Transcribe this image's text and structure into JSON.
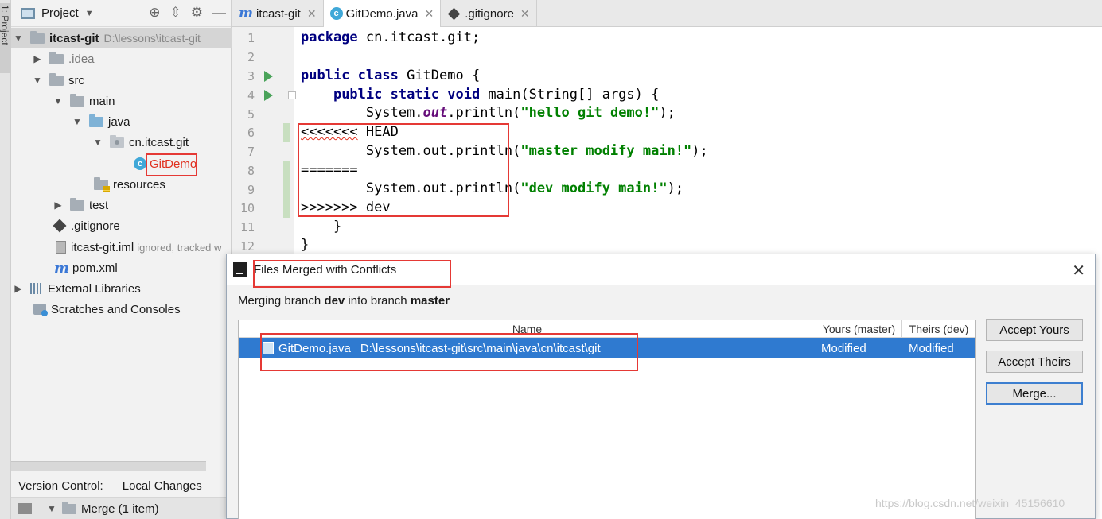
{
  "sidebar_tab": "1: Project",
  "project_panel": {
    "title": "Project",
    "tree": [
      {
        "label": "itcast-git",
        "hint": "D:\\lessons\\itcast-git"
      },
      {
        "label": ".idea"
      },
      {
        "label": "src"
      },
      {
        "label": "main"
      },
      {
        "label": "java"
      },
      {
        "label": "cn.itcast.git"
      },
      {
        "label": "GitDemo"
      },
      {
        "label": "resources"
      },
      {
        "label": "test"
      },
      {
        "label": ".gitignore"
      },
      {
        "label": "itcast-git.iml",
        "hint": "ignored, tracked w"
      },
      {
        "label": "pom.xml"
      },
      {
        "label": "External Libraries"
      },
      {
        "label": "Scratches and Consoles"
      }
    ]
  },
  "version_control": {
    "label": "Version Control:",
    "tab": "Local Changes",
    "group": "Merge (1 item)"
  },
  "editor": {
    "tabs": [
      {
        "label": "itcast-git"
      },
      {
        "label": "GitDemo.java"
      },
      {
        "label": ".gitignore"
      }
    ],
    "code": {
      "l1_kw": "package",
      "l1_rest": " cn.itcast.git;",
      "l3_kw1": "public",
      "l3_kw2": "class",
      "l3_rest": " GitDemo {",
      "l4_kw": "public static void",
      "l4_rest": " main(String[] args) {",
      "l5_pre": "        System.",
      "l5_field": "out",
      "l5_mid": ".println(",
      "l5_str": "\"hello git demo!\"",
      "l5_end": ");",
      "l6_marker": "<<<<<<<",
      "l6_rest": " HEAD",
      "l7_pre": "        System.out.println(",
      "l7_str": "\"master modify main!\"",
      "l7_end": ");",
      "l8": "=======",
      "l9_pre": "        System.out.println(",
      "l9_str": "\"dev modify main!\"",
      "l9_end": ");",
      "l10": ">>>>>>> dev",
      "l11": "    }",
      "l12": "}"
    }
  },
  "dialog": {
    "title": "Files Merged with Conflicts",
    "msg_prefix": "Merging branch ",
    "msg_branch1": "dev",
    "msg_mid": " into branch ",
    "msg_branch2": "master",
    "columns": [
      "Name",
      "Yours (master)",
      "Theirs (dev)"
    ],
    "rows": [
      {
        "file": "GitDemo.java",
        "path": "D:\\lessons\\itcast-git\\src\\main\\java\\cn\\itcast\\git",
        "yours": "Modified",
        "theirs": "Modified"
      }
    ],
    "buttons": {
      "accept_yours": "Accept Yours",
      "accept_theirs": "Accept Theirs",
      "merge": "Merge..."
    }
  },
  "watermark": "https://blog.csdn.net/weixin_45156610"
}
